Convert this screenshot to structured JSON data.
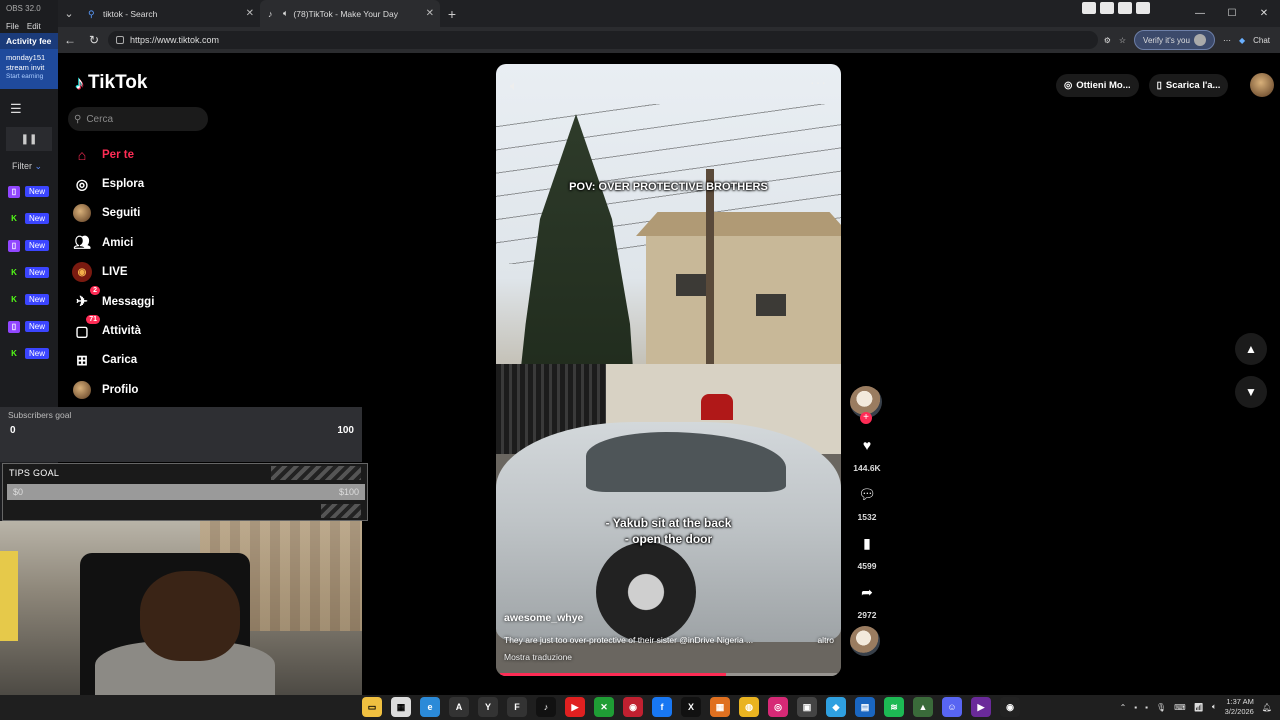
{
  "obs": {
    "title": "OBS 32.0",
    "menu": [
      "File",
      "Edit"
    ],
    "activity_feed": "Activity fee",
    "invite_user": "monday151",
    "invite_text": "stream invit",
    "invite_sub": "Start earning",
    "filter": "Filter",
    "rows": [
      {
        "platform": "twitch-icon",
        "badge": "New"
      },
      {
        "platform": "kick-icon",
        "badge": "New"
      },
      {
        "platform": "twitch-icon",
        "badge": "New"
      },
      {
        "platform": "kick-icon",
        "badge": "New"
      },
      {
        "platform": "kick-icon",
        "badge": "New"
      },
      {
        "platform": "twitch-icon",
        "badge": "New"
      },
      {
        "platform": "kick-icon",
        "badge": "New"
      }
    ]
  },
  "browser": {
    "tabs": [
      {
        "title": "tiktok - Search"
      },
      {
        "title": "(78)TikTok - Make Your Day"
      }
    ],
    "url": "https://www.tiktok.com",
    "verify": "Verify it's you",
    "chat": "Chat"
  },
  "tiktok": {
    "logo": "TikTok",
    "search_placeholder": "Cerca",
    "nav": [
      {
        "label": "Per te",
        "icon": "home-icon",
        "active": true
      },
      {
        "label": "Esplora",
        "icon": "compass-icon"
      },
      {
        "label": "Seguiti",
        "icon": "following-avatar-icon"
      },
      {
        "label": "Amici",
        "icon": "friends-icon"
      },
      {
        "label": "LIVE",
        "icon": "live-icon"
      },
      {
        "label": "Messaggi",
        "icon": "messages-icon",
        "badge": "2"
      },
      {
        "label": "Attività",
        "icon": "activity-icon",
        "badge": "71"
      },
      {
        "label": "Carica",
        "icon": "upload-icon"
      },
      {
        "label": "Profilo",
        "icon": "profile-avatar-icon"
      }
    ],
    "header": {
      "coins": "Ottieni Mo...",
      "download": "Scarica l'a..."
    }
  },
  "overlays": {
    "subscribers_label": "Subscribers goal",
    "subscribers_current": "0",
    "subscribers_target": "100",
    "tips_label": "TIPS GOAL",
    "tips_current": "$0",
    "tips_target": "$100"
  },
  "video": {
    "caption_top": "POV: OVER PROTECTIVE BROTHERS",
    "caption_mid_1": "- Yakub sit at the back",
    "caption_mid_2": "- open the door",
    "author": "awesome_whye",
    "description": "They are just too over-protective of their sister @inDrive Nigeria ...",
    "more": "altro",
    "translate": "Mostra traduzione",
    "progress": 0.67,
    "likes": "144.6K",
    "comments": "1532",
    "saves": "4599",
    "shares": "2972"
  },
  "taskbar": {
    "time": "1:37 AM",
    "date": "3/2/2026"
  },
  "colors": {
    "accent": "#fe2c55",
    "background": "#000000"
  }
}
